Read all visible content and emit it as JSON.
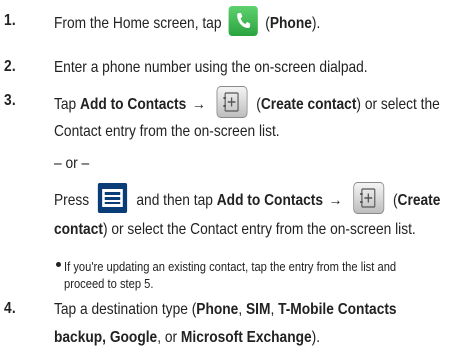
{
  "steps": [
    {
      "number": "1.",
      "text_before": "From the Home screen, tap",
      "icon": "phone-icon",
      "label": "Phone"
    },
    {
      "number": "2.",
      "text": "Enter a phone number using the on-screen dialpad."
    },
    {
      "number": "3.",
      "tap": "Tap",
      "add_to_contacts": "Add to Contacts",
      "arrow": "→",
      "icon": "create-contact-icon",
      "create_contact": "Create contact",
      "or_select": "or select the",
      "line2": "Contact entry from the on-screen list.",
      "or": "– or –",
      "press": "Press",
      "menu_icon": "menu-icon",
      "and_then_tap": "and then tap",
      "create_word": "Create",
      "contact_word": "contact",
      "line_end": "or select the Contact entry from the on-screen list.",
      "bullet": {
        "line1": "If you're updating an existing contact, tap the entry from the list and",
        "line2": "proceed to step 5."
      }
    },
    {
      "number": "4.",
      "text_before": "Tap a destination type (",
      "phone": "Phone",
      "sim": "SIM",
      "tmobile": "T-Mobile Contacts",
      "backup_google": "backup, Google",
      "or_text": ", or",
      "exchange": "Microsoft Exchange",
      "end": ")."
    }
  ],
  "colors": {
    "phone_icon_green": "#2aa33f",
    "menu_icon_blue": "#0a3d78",
    "text": "#222222"
  }
}
